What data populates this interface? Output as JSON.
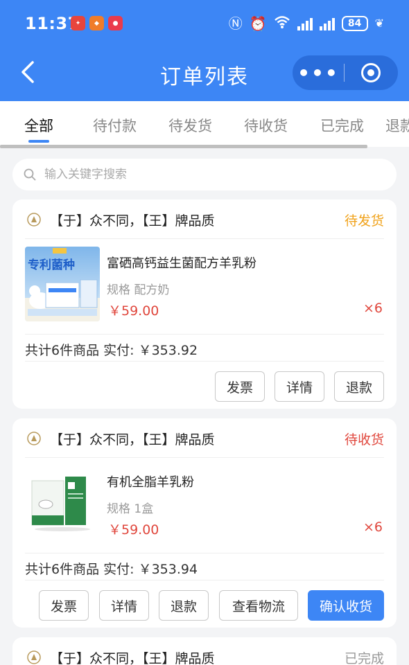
{
  "status_bar": {
    "time": "11:37",
    "battery": "84"
  },
  "nav": {
    "title": "订单列表",
    "more": "•••"
  },
  "tabs": [
    {
      "label": "全部"
    },
    {
      "label": "待付款"
    },
    {
      "label": "待发货"
    },
    {
      "label": "待收货"
    },
    {
      "label": "已完成"
    },
    {
      "label": "退款"
    }
  ],
  "search": {
    "placeholder": "输入关键字搜索"
  },
  "colors": {
    "accent": "#3d86f5",
    "status_pending_ship": "#f0a21a",
    "status_pending_receive": "#e0473d",
    "status_done": "#999999",
    "price": "#e0473d"
  },
  "orders": [
    {
      "shop": "【于】众不同，【王】牌品质",
      "status": "待发货",
      "product": {
        "name": "富硒高钙益生菌配方羊乳粉",
        "spec": "规格 配方奶",
        "price": "￥59.00",
        "qty": "×6",
        "image_text": "专利菌种"
      },
      "total": "共计6件商品 实付: ￥353.92",
      "buttons": [
        "发票",
        "详情",
        "退款"
      ]
    },
    {
      "shop": "【于】众不同，【王】牌品质",
      "status": "待收货",
      "product": {
        "name": "有机全脂羊乳粉",
        "spec": "规格 1盒",
        "price": "￥59.00",
        "qty": "×6"
      },
      "total": "共计6件商品 实付: ￥353.94",
      "buttons": [
        "发票",
        "详情",
        "退款",
        "查看物流",
        "确认收货"
      ]
    },
    {
      "shop": "【于】众不同，【王】牌品质",
      "status": "已完成"
    }
  ]
}
